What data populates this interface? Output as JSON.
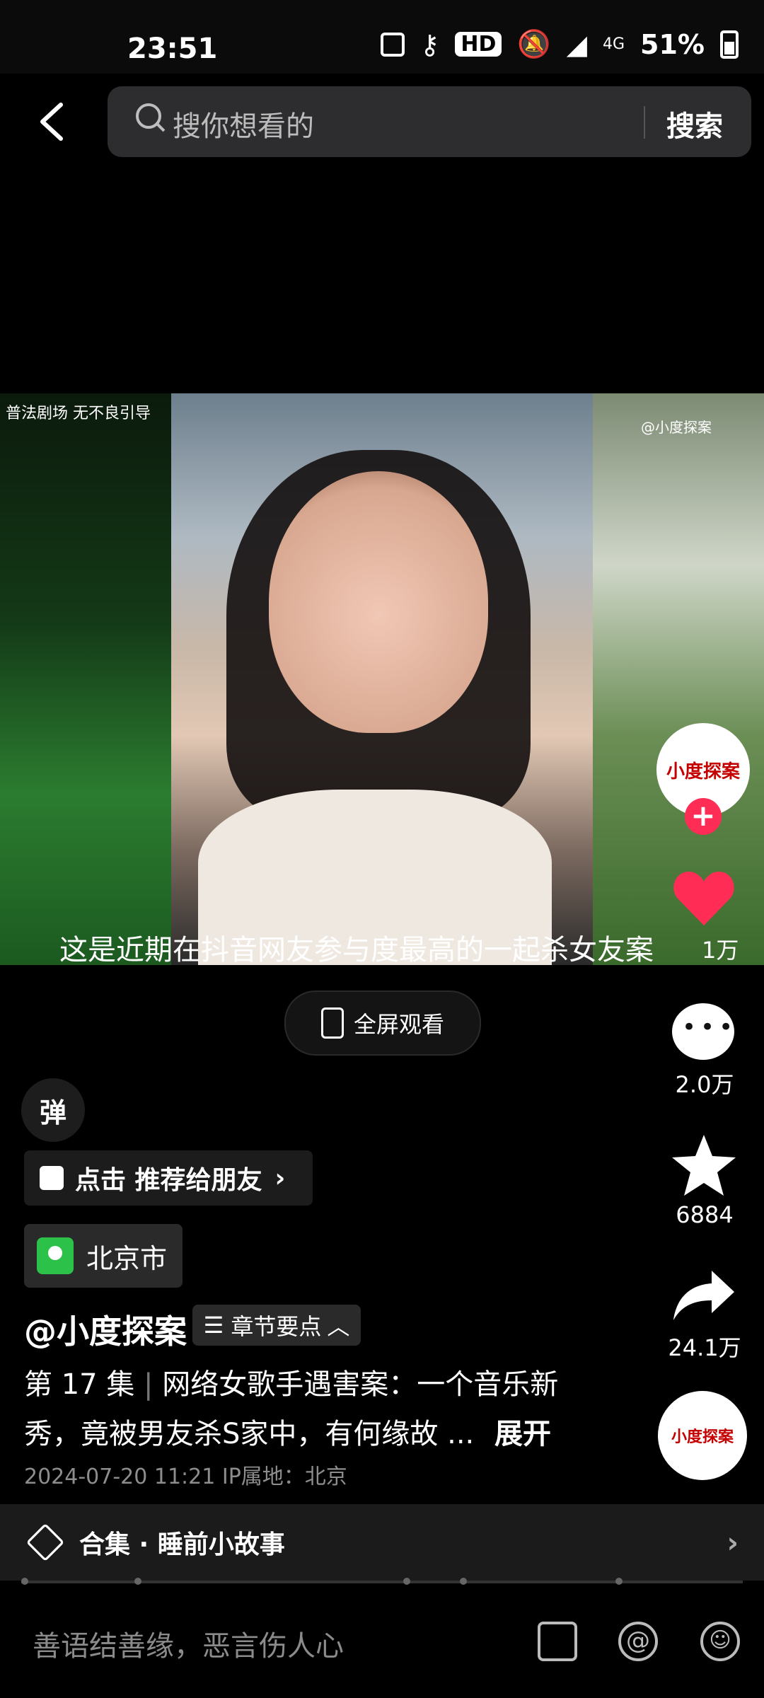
{
  "status_bar": {
    "time": "23:51",
    "hd": "HD",
    "network": "4G",
    "battery": "51%"
  },
  "header": {
    "search_placeholder": "搜你想看的",
    "search_button": "搜索"
  },
  "video": {
    "overlay_top_left": "普法剧场 无不良引导",
    "overlay_top_right": "@小度探案",
    "subtitle": "这是近期在抖音网友参与度最高的一起杀女友案"
  },
  "actions": {
    "likes": "1万",
    "comments": "2.0万",
    "favorites": "6884",
    "shares": "24.1万",
    "avatar_text": "小度探案"
  },
  "fullscreen_label": "全屏观看",
  "danmu_label": "弹",
  "recommend_label": "点击 推荐给朋友",
  "location_label": "北京市",
  "author": "@小度探案",
  "chapter_label": "章节要点",
  "description": {
    "episode": "第 17 集",
    "text": "网络女歌手遇害案：一个音乐新秀，竟被男友杀S家中，有何缘故 ...",
    "expand": "展开"
  },
  "datetime": "2024-07-20 11:21  IP属地：北京",
  "collection": {
    "label": "合集 · 睡前小故事"
  },
  "comment_input": {
    "placeholder": "善语结善缘，恶言伤人心"
  }
}
